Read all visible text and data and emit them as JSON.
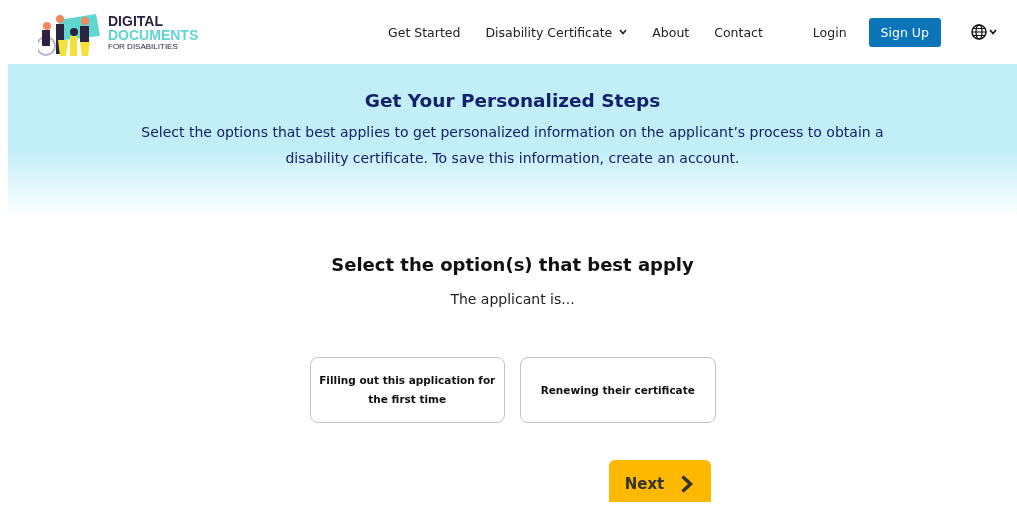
{
  "logo": {
    "line_1": "DIGITAL",
    "line_2": "DOCUMENTS",
    "line_3": "FOR DISABILITIES"
  },
  "nav": [
    {
      "label": "Get Started",
      "kind": "link"
    },
    {
      "label": "Disability Certificate",
      "kind": "dropdown"
    },
    {
      "label": "About",
      "kind": "link"
    },
    {
      "label": "Contact",
      "kind": "link"
    }
  ],
  "login": "Login",
  "signup": "Sign Up",
  "hero": {
    "title": "Get Your Personalized Steps",
    "text": "Select the options that best applies to get personalized information on the applicant’s process to obtain a disability certificate. To save this information, create an account."
  },
  "question": {
    "title": "Select the option(s) that best apply",
    "subtitle": "The applicant is..."
  },
  "options": [
    {
      "label": "Filling out this application for the first time",
      "selected": false
    },
    {
      "label": "Renewing their certificate",
      "selected": false
    }
  ],
  "next_button": "Next"
}
